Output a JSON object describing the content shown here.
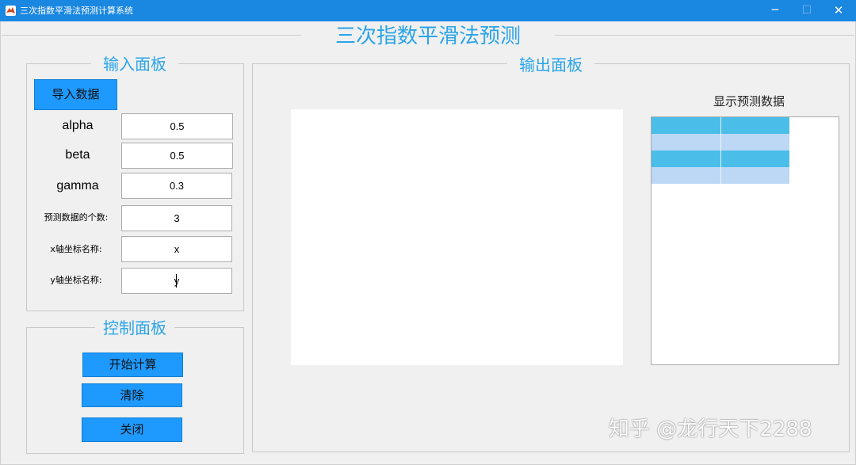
{
  "window": {
    "title": "三次指数平滑法预测计算系统",
    "minimize_glyph": "─",
    "maximize_glyph": "☐",
    "close_glyph": "✕"
  },
  "main_title": "三次指数平滑法预测",
  "input_panel": {
    "title": "输入面板",
    "import_button": "导入数据",
    "params": [
      {
        "label": "alpha",
        "value": "0.5"
      },
      {
        "label": "beta",
        "value": "0.5"
      },
      {
        "label": "gamma",
        "value": "0.3"
      },
      {
        "label": "预测数据的个数:",
        "value": "3"
      },
      {
        "label": "x轴坐标名称:",
        "value": "x"
      },
      {
        "label": "y轴坐标名称:",
        "value": "y"
      }
    ]
  },
  "control_panel": {
    "title": "控制面板",
    "start_button": "开始计算",
    "clear_button": "清除",
    "close_button": "关闭"
  },
  "output_panel": {
    "title": "输出面板",
    "table_title": "显示预测数据",
    "table_rows": 4
  },
  "watermark": "知乎 @龙行天下2288",
  "colors": {
    "titlebar": "#1a87e0",
    "panel_title": "#2aa4e8",
    "button": "#1e9aff",
    "table_row_dark": "#4bbde9",
    "table_row_light": "#bcd8f5"
  }
}
